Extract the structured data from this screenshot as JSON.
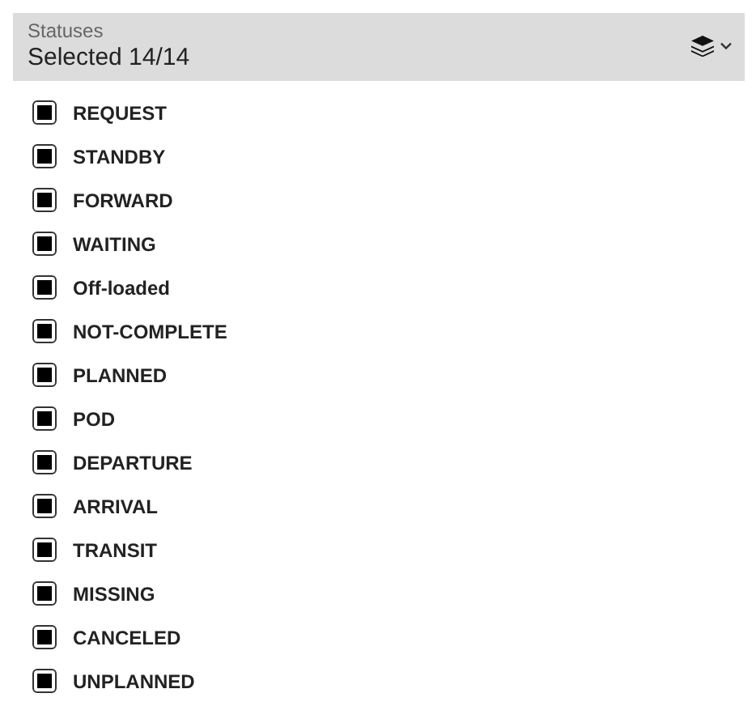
{
  "header": {
    "label": "Statuses",
    "value": "Selected 14/14"
  },
  "statuses": [
    {
      "label": "REQUEST",
      "checked": true
    },
    {
      "label": "STANDBY",
      "checked": true
    },
    {
      "label": "FORWARD",
      "checked": true
    },
    {
      "label": "WAITING",
      "checked": true
    },
    {
      "label": "Off-loaded",
      "checked": true
    },
    {
      "label": "NOT-COMPLETE",
      "checked": true
    },
    {
      "label": "PLANNED",
      "checked": true
    },
    {
      "label": "POD",
      "checked": true
    },
    {
      "label": "DEPARTURE",
      "checked": true
    },
    {
      "label": "ARRIVAL",
      "checked": true
    },
    {
      "label": "TRANSIT",
      "checked": true
    },
    {
      "label": "MISSING",
      "checked": true
    },
    {
      "label": "CANCELED",
      "checked": true
    },
    {
      "label": "UNPLANNED",
      "checked": true
    }
  ]
}
